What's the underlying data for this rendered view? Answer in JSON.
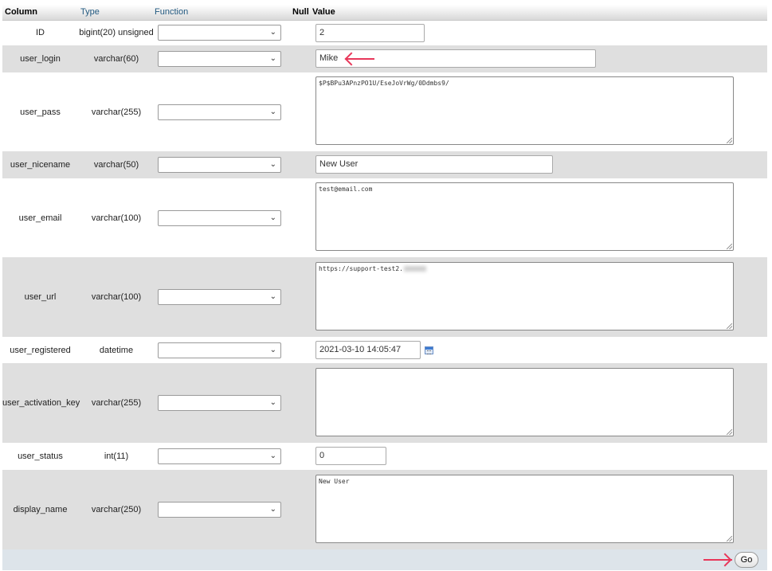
{
  "header": {
    "column": "Column",
    "type": "Type",
    "function": "Function",
    "null": "Null",
    "value": "Value"
  },
  "rows": [
    {
      "column": "ID",
      "type": "bigint(20) unsigned",
      "function": "",
      "value": "2"
    },
    {
      "column": "user_login",
      "type": "varchar(60)",
      "function": "",
      "value": "Mike"
    },
    {
      "column": "user_pass",
      "type": "varchar(255)",
      "function": "",
      "value": "$P$BPu3APnzPO1U/EseJoVrWg/0Ddmbs9/"
    },
    {
      "column": "user_nicename",
      "type": "varchar(50)",
      "function": "",
      "value": "New User"
    },
    {
      "column": "user_email",
      "type": "varchar(100)",
      "function": "",
      "value": "test@email.com"
    },
    {
      "column": "user_url",
      "type": "varchar(100)",
      "function": "",
      "value": "https://support-test2."
    },
    {
      "column": "user_registered",
      "type": "datetime",
      "function": "",
      "value": "2021-03-10 14:05:47"
    },
    {
      "column": "user_activation_key",
      "type": "varchar(255)",
      "function": "",
      "value": ""
    },
    {
      "column": "user_status",
      "type": "int(11)",
      "function": "",
      "value": "0"
    },
    {
      "column": "display_name",
      "type": "varchar(250)",
      "function": "",
      "value": "New User"
    }
  ],
  "footer": {
    "go_label": "Go"
  },
  "icons": {
    "select_chevron": "chevron-down-icon",
    "calendar": "calendar-icon",
    "arrow_user_login": "arrow-left-icon",
    "arrow_go": "arrow-right-icon"
  },
  "colors": {
    "arrow": "#e8375a",
    "header_link": "#235a81",
    "even_row": "#dfdfdf",
    "footer": "#dde4ea"
  }
}
